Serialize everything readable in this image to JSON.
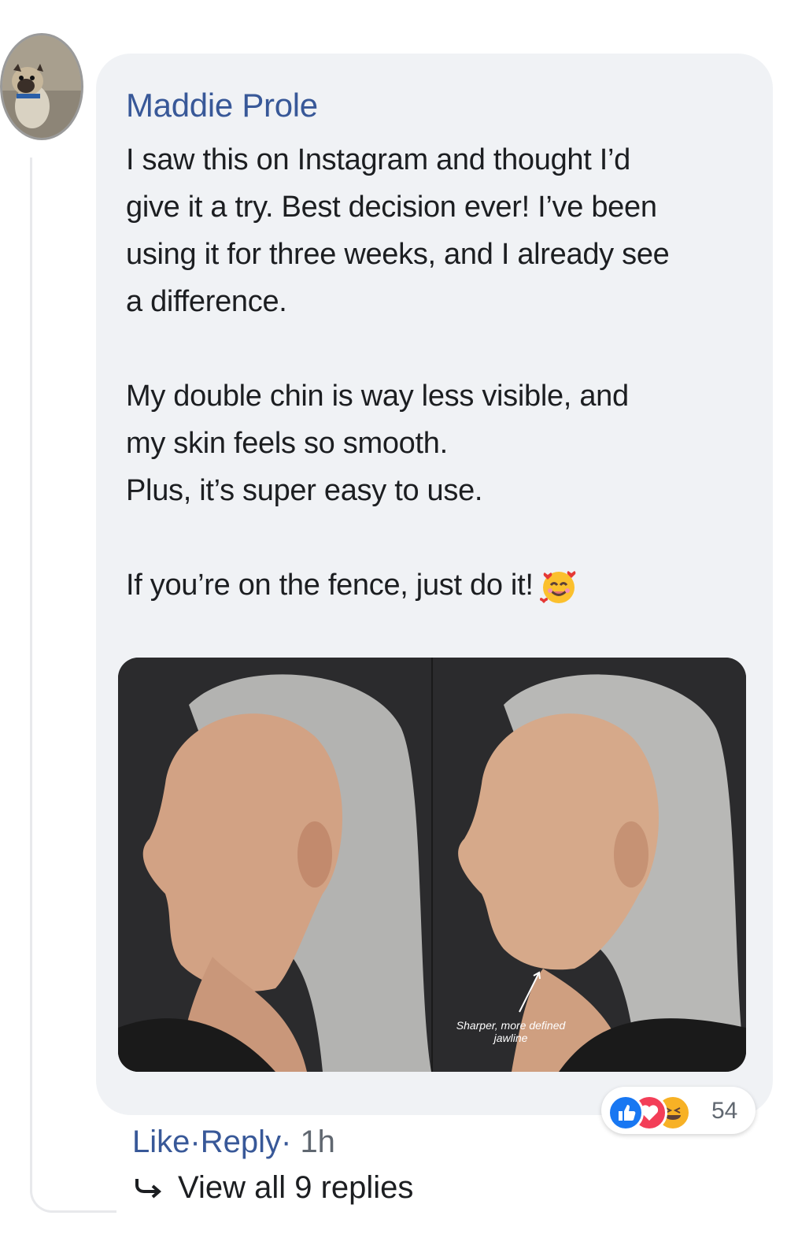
{
  "comment": {
    "author": "Maddie Prole",
    "paragraphs": [
      [
        "I saw this on Instagram and thought I’d",
        "give it a try. Best decision ever! I’ve been",
        "using it for three weeks, and I already see",
        "a difference."
      ],
      [
        "My double chin is way less visible, and",
        "my skin feels so smooth.",
        "Plus, it’s super easy to use."
      ],
      [
        "If you’re on the fence, just do it!"
      ]
    ],
    "emoji": "smiling-face-with-hearts",
    "photo_caption": [
      "Sharper, more defined",
      "jawline"
    ]
  },
  "reactions": {
    "icons": [
      "like-icon",
      "love-icon",
      "haha-icon"
    ],
    "count": "54"
  },
  "actions": {
    "like": "Like",
    "separator": "·",
    "reply": "Reply",
    "separator2": "·",
    "time": "1h"
  },
  "replies": {
    "label": "View all 9 replies"
  },
  "colors": {
    "author": "#385898",
    "bubble": "#f0f2f5",
    "like": "#1877f2",
    "love": "#f33e58",
    "haha": "#f7b125"
  }
}
